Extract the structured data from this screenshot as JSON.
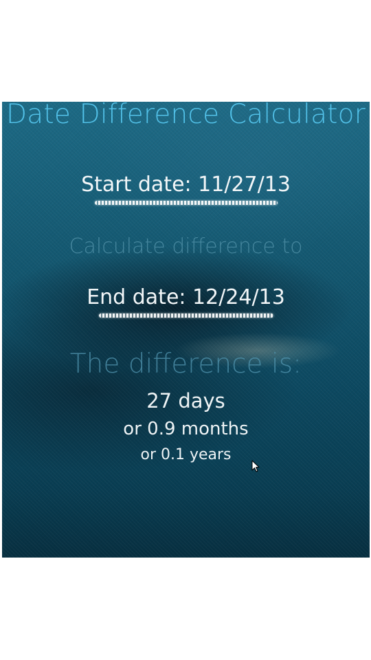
{
  "app": {
    "title": "Date Difference Calculator"
  },
  "start_date": {
    "label": "Start date: 11/27/13"
  },
  "middle_label": "Calculate difference to",
  "end_date": {
    "label": "End date: 12/24/13"
  },
  "result": {
    "heading": "The difference is:",
    "days": "27 days",
    "months": "or 0.9 months",
    "years": "or 0.1 years"
  },
  "colors": {
    "accent": "#52c1e8",
    "background_top": "#1d6a85",
    "background_bottom": "#072f40",
    "text": "#eef3f5"
  },
  "icons": {
    "pointer": "mouse-pointer-icon"
  }
}
